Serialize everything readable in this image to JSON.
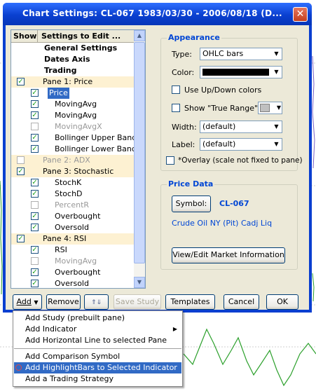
{
  "window": {
    "title": "Chart Settings:  CL-067  1983/03/30 - 2006/08/18  (D...",
    "close_glyph": "✕"
  },
  "list": {
    "col_show": "Show",
    "col_settings": "Settings to Edit ...",
    "rows": [
      {
        "label": "General Settings",
        "checkbox": "none",
        "bold": true
      },
      {
        "label": "Dates Axis",
        "checkbox": "none",
        "bold": true
      },
      {
        "label": "Trading",
        "checkbox": "none",
        "bold": true
      },
      {
        "label": "Pane 1:  Price",
        "checkbox": "checked",
        "pane": true
      },
      {
        "label": "Price",
        "checkbox": "checked",
        "selected": true
      },
      {
        "label": "MovingAvg",
        "checkbox": "checked"
      },
      {
        "label": "MovingAvg",
        "checkbox": "checked"
      },
      {
        "label": "MovingAvgX",
        "checkbox": "unchecked",
        "dim": true
      },
      {
        "label": "Bollinger Upper Band",
        "checkbox": "checked"
      },
      {
        "label": "Bollinger Lower Band",
        "checkbox": "checked"
      },
      {
        "label": "Pane 2:  ADX",
        "checkbox": "unchecked",
        "pane": true,
        "dim": true
      },
      {
        "label": "Pane 3:  Stochastic",
        "checkbox": "checked",
        "pane": true
      },
      {
        "label": "StochK",
        "checkbox": "checked"
      },
      {
        "label": "StochD",
        "checkbox": "checked"
      },
      {
        "label": "PercentR",
        "checkbox": "unchecked",
        "dim": true
      },
      {
        "label": "Overbought",
        "checkbox": "checked"
      },
      {
        "label": "Oversold",
        "checkbox": "checked"
      },
      {
        "label": "Pane 4:  RSI",
        "checkbox": "checked",
        "pane": true
      },
      {
        "label": "RSI",
        "checkbox": "checked"
      },
      {
        "label": "MovingAvg",
        "checkbox": "unchecked",
        "dim": true
      },
      {
        "label": "Overbought",
        "checkbox": "checked"
      },
      {
        "label": "Oversold",
        "checkbox": "checked"
      }
    ]
  },
  "appearance": {
    "group_title": "Appearance",
    "type_label": "Type:",
    "type_value": "OHLC bars",
    "color_label": "Color:",
    "color_value": "#000000",
    "updown_label": "Use Up/Down colors",
    "truerange_label": "Show \"True Range\":",
    "width_label": "Width:",
    "width_value": "(default)",
    "label_label": "Label:",
    "label_value": "(default)",
    "overlay_label": "*Overlay (scale not fixed to pane)"
  },
  "price_data": {
    "group_title": "Price Data",
    "symbol_button": "Symbol:",
    "symbol_value": "CL-067",
    "description": "Crude Oil NY (Pit) Cadj Liq",
    "market_info_button": "View/Edit Market Information"
  },
  "buttons": {
    "add": "Add",
    "remove": "Remove",
    "save_study": "Save Study",
    "templates": "Templates",
    "cancel": "Cancel",
    "ok": "OK"
  },
  "menu": {
    "items": [
      "Add Study (prebuilt pane)",
      "Add Indicator",
      "Add Horizontal Line to selected Pane",
      "Add Comparison Symbol",
      "Add HighlightBars to Selected Indicator",
      "Add a Trading Strategy"
    ],
    "highlighted_index": 4
  },
  "colors": {
    "accent": "#316ac5",
    "title_bar": "#0a3fd0",
    "group_title": "#0046d5",
    "pane_row": "#fdf1d2"
  }
}
